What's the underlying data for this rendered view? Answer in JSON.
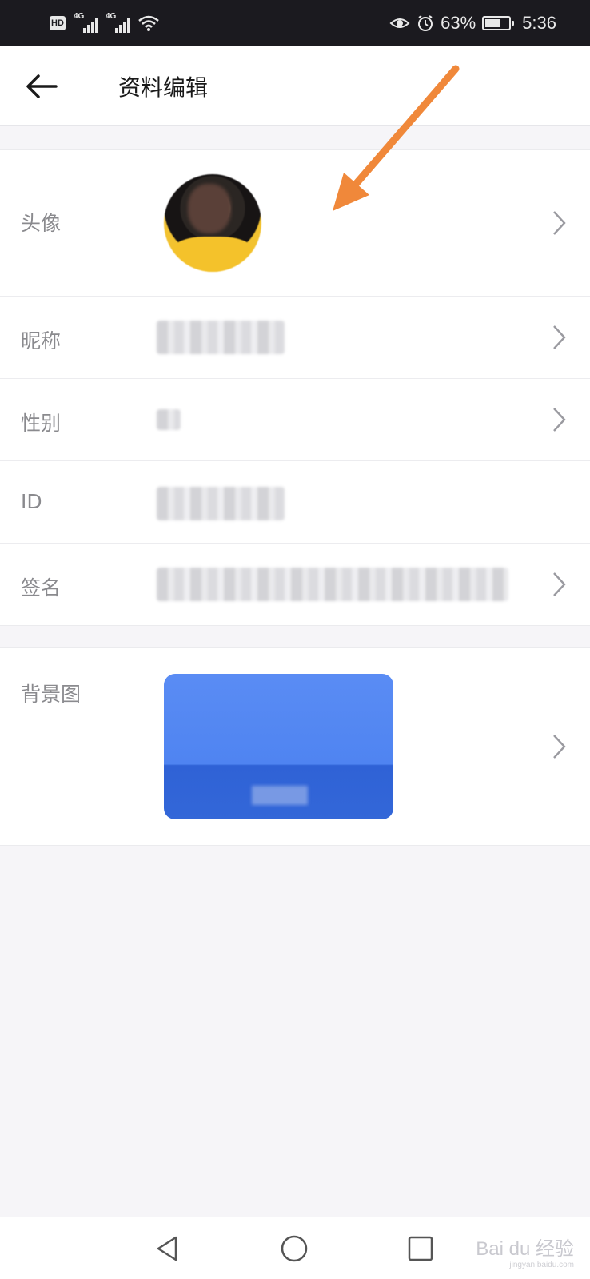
{
  "status_bar": {
    "hd_label": "HD",
    "network1": "4G",
    "network2": "4G",
    "battery_percent_text": "63%",
    "battery_level": 0.63,
    "time": "5:36"
  },
  "header": {
    "title": "资料编辑"
  },
  "profile": {
    "avatar_label": "头像",
    "nickname_label": "昵称",
    "gender_label": "性别",
    "id_label": "ID",
    "signature_label": "签名",
    "background_label": "背景图"
  },
  "watermark": {
    "text": "Bai du 经验",
    "sub": "jingyan.baidu.com"
  },
  "colors": {
    "arrow": "#f0883a",
    "background_accent": "#4f84f1"
  }
}
